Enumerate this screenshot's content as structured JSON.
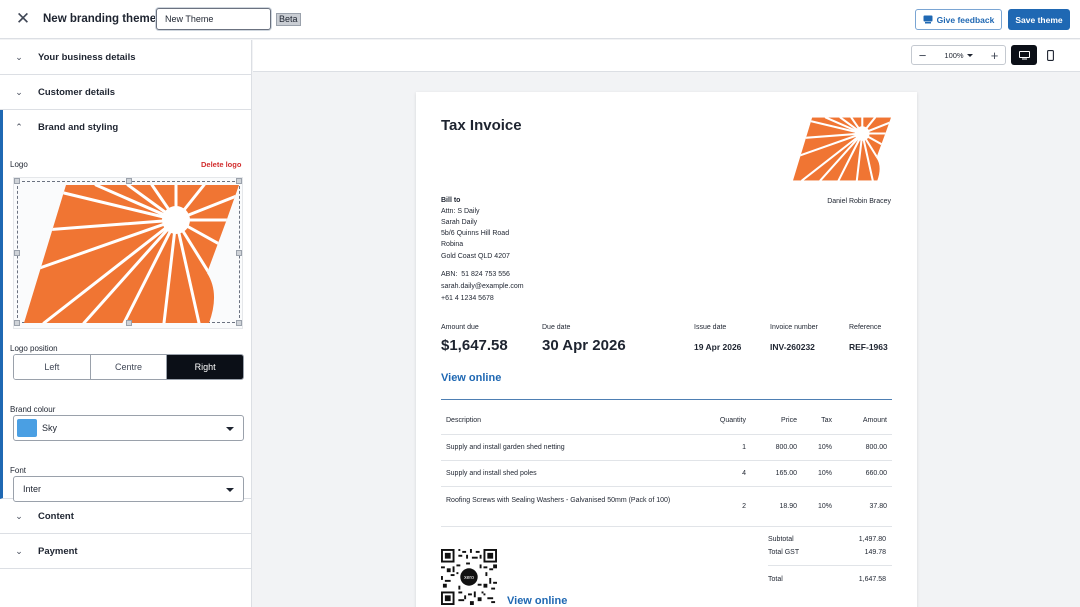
{
  "topbar": {
    "close_icon": "close-icon",
    "title": "New branding theme",
    "theme_name_value": "New Theme",
    "beta_label": "Beta",
    "feedback_label": "Give feedback",
    "save_label": "Save theme"
  },
  "sidebar": {
    "sections": {
      "business": "Your business details",
      "customer": "Customer details",
      "brand": "Brand and styling",
      "content": "Content",
      "payment": "Payment"
    },
    "brand": {
      "logo_label": "Logo",
      "delete_logo": "Delete logo",
      "logo_position_label": "Logo position",
      "positions": [
        "Left",
        "Centre",
        "Right"
      ],
      "selected_position": "Right",
      "brand_colour_label": "Brand colour",
      "brand_colour_value": "Sky",
      "brand_colour_hex": "#4a9fe3",
      "font_label": "Font",
      "font_value": "Inter"
    }
  },
  "preview_toolbar": {
    "zoom": "100%",
    "zoom_out_icon": "minus-icon",
    "zoom_in_icon": "plus-icon",
    "desktop_view_icon": "desktop-icon",
    "mobile_view_icon": "mobile-icon"
  },
  "invoice": {
    "title": "Tax Invoice",
    "brand_color": "#f07533",
    "from_name": "Daniel Robin Bracey",
    "bill_to_label": "Bill to",
    "bill_to_lines": [
      "Attn: S Daily",
      "Sarah Daily",
      "5b/6 Quinns Hill Road",
      "Robina",
      "Gold Coast QLD 4207"
    ],
    "contact_lines": [
      "ABN:  51 824 753 556",
      "sarah.daily@example.com",
      "+61 4 1234 5678"
    ],
    "amount_due_label": "Amount due",
    "amount_due": "$1,647.58",
    "due_date_label": "Due date",
    "due_date": "30 Apr 2026",
    "issue_date_label": "Issue date",
    "issue_date": "19 Apr 2026",
    "invoice_number_label": "Invoice number",
    "invoice_number": "INV-260232",
    "reference_label": "Reference",
    "reference": "REF-1963",
    "view_online": "View online",
    "table": {
      "headers": [
        "Description",
        "Quantity",
        "Price",
        "Tax",
        "Amount"
      ],
      "rows": [
        [
          "Supply and install garden shed netting",
          "1",
          "800.00",
          "10%",
          "800.00"
        ],
        [
          "Supply and install shed poles",
          "4",
          "165.00",
          "10%",
          "660.00"
        ],
        [
          "Roofing Screws with Sealing Washers - Galvanised 50mm (Pack of 100)",
          "2",
          "18.90",
          "10%",
          "37.80"
        ]
      ]
    },
    "subtotal_label": "Subtotal",
    "subtotal": "1,497.80",
    "gst_label": "Total GST",
    "gst": "149.78",
    "total_label": "Total",
    "total": "1,647.58",
    "qr_label": "xero",
    "view_online_bottom": "View online"
  }
}
